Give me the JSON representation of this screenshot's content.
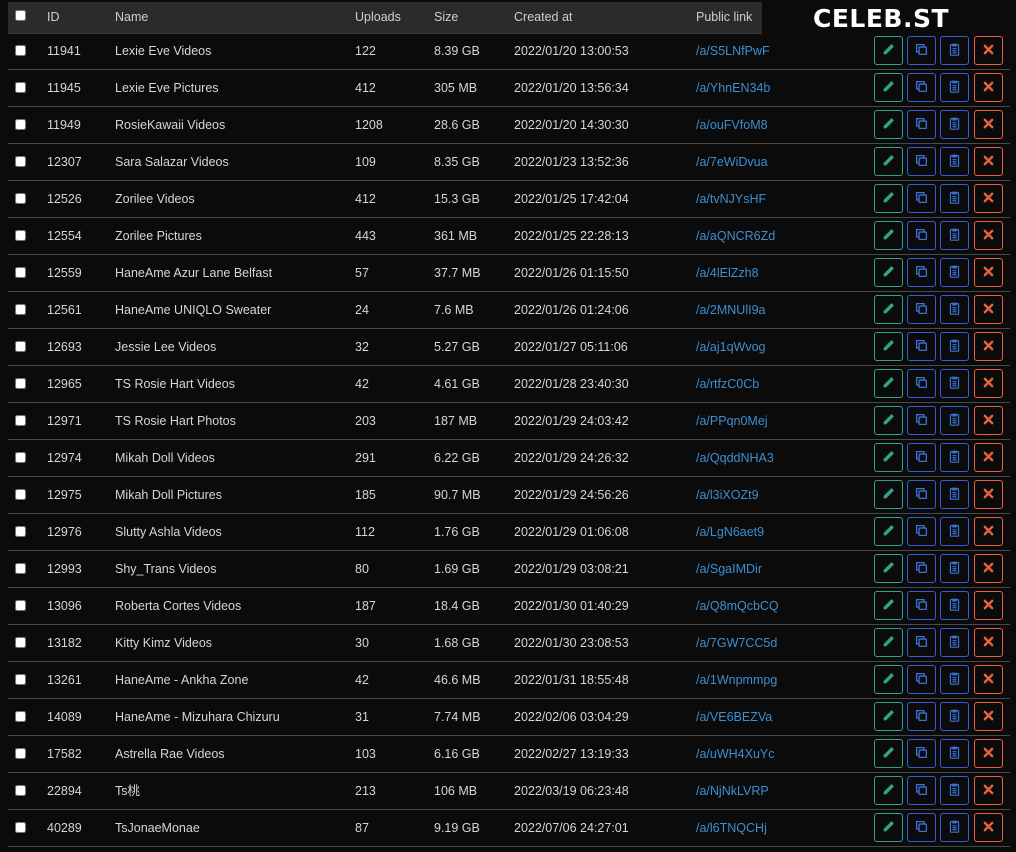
{
  "brand": {
    "logo": "CELEB.ST"
  },
  "table": {
    "headers": {
      "id": "ID",
      "name": "Name",
      "uploads": "Uploads",
      "size": "Size",
      "created": "Created at",
      "link": "Public link"
    },
    "rows": [
      {
        "id": "11941",
        "name": "Lexie Eve Videos",
        "uploads": "122",
        "size": "8.39 GB",
        "created": "2022/01/20 13:00:53",
        "link": "/a/S5LNfPwF"
      },
      {
        "id": "11945",
        "name": "Lexie Eve Pictures",
        "uploads": "412",
        "size": "305 MB",
        "created": "2022/01/20 13:56:34",
        "link": "/a/YhnEN34b"
      },
      {
        "id": "11949",
        "name": "RosieKawaii Videos",
        "uploads": "1208",
        "size": "28.6 GB",
        "created": "2022/01/20 14:30:30",
        "link": "/a/ouFVfoM8"
      },
      {
        "id": "12307",
        "name": "Sara Salazar Videos",
        "uploads": "109",
        "size": "8.35 GB",
        "created": "2022/01/23 13:52:36",
        "link": "/a/7eWiDvua"
      },
      {
        "id": "12526",
        "name": "Zorilee Videos",
        "uploads": "412",
        "size": "15.3 GB",
        "created": "2022/01/25 17:42:04",
        "link": "/a/tvNJYsHF"
      },
      {
        "id": "12554",
        "name": "Zorilee Pictures",
        "uploads": "443",
        "size": "361 MB",
        "created": "2022/01/25 22:28:13",
        "link": "/a/aQNCR6Zd"
      },
      {
        "id": "12559",
        "name": "HaneAme Azur Lane Belfast",
        "uploads": "57",
        "size": "37.7 MB",
        "created": "2022/01/26 01:15:50",
        "link": "/a/4lElZzh8"
      },
      {
        "id": "12561",
        "name": "HaneAme UNIQLO Sweater",
        "uploads": "24",
        "size": "7.6 MB",
        "created": "2022/01/26 01:24:06",
        "link": "/a/2MNUlI9a"
      },
      {
        "id": "12693",
        "name": "Jessie Lee Videos",
        "uploads": "32",
        "size": "5.27 GB",
        "created": "2022/01/27 05:11:06",
        "link": "/a/aj1qWvog"
      },
      {
        "id": "12965",
        "name": "TS Rosie Hart Videos",
        "uploads": "42",
        "size": "4.61 GB",
        "created": "2022/01/28 23:40:30",
        "link": "/a/rtfzC0Cb"
      },
      {
        "id": "12971",
        "name": "TS Rosie Hart Photos",
        "uploads": "203",
        "size": "187 MB",
        "created": "2022/01/29 24:03:42",
        "link": "/a/PPqn0Mej"
      },
      {
        "id": "12974",
        "name": "Mikah Doll Videos",
        "uploads": "291",
        "size": "6.22 GB",
        "created": "2022/01/29 24:26:32",
        "link": "/a/QqddNHA3"
      },
      {
        "id": "12975",
        "name": "Mikah Doll Pictures",
        "uploads": "185",
        "size": "90.7 MB",
        "created": "2022/01/29 24:56:26",
        "link": "/a/l3iXOZt9"
      },
      {
        "id": "12976",
        "name": "Slutty Ashla Videos",
        "uploads": "112",
        "size": "1.76 GB",
        "created": "2022/01/29 01:06:08",
        "link": "/a/LgN6aet9"
      },
      {
        "id": "12993",
        "name": "Shy_Trans Videos",
        "uploads": "80",
        "size": "1.69 GB",
        "created": "2022/01/29 03:08:21",
        "link": "/a/SgaIMDir"
      },
      {
        "id": "13096",
        "name": "Roberta Cortes Videos",
        "uploads": "187",
        "size": "18.4 GB",
        "created": "2022/01/30 01:40:29",
        "link": "/a/Q8mQcbCQ"
      },
      {
        "id": "13182",
        "name": "Kitty Kimz Videos",
        "uploads": "30",
        "size": "1.68 GB",
        "created": "2022/01/30 23:08:53",
        "link": "/a/7GW7CC5d"
      },
      {
        "id": "13261",
        "name": "HaneAme - Ankha Zone",
        "uploads": "42",
        "size": "46.6 MB",
        "created": "2022/01/31 18:55:48",
        "link": "/a/1Wnpmmpg"
      },
      {
        "id": "14089",
        "name": "HaneAme - Mizuhara Chizuru",
        "uploads": "31",
        "size": "7.74 MB",
        "created": "2022/02/06 03:04:29",
        "link": "/a/VE6BEZVa"
      },
      {
        "id": "17582",
        "name": "Astrella Rae Videos",
        "uploads": "103",
        "size": "6.16 GB",
        "created": "2022/02/27 13:19:33",
        "link": "/a/uWH4XuYc"
      },
      {
        "id": "22894",
        "name": "Ts桃",
        "uploads": "213",
        "size": "106 MB",
        "created": "2022/03/19 06:23:48",
        "link": "/a/NjNkLVRP"
      },
      {
        "id": "40289",
        "name": "TsJonaeMonae",
        "uploads": "87",
        "size": "9.19 GB",
        "created": "2022/07/06 24:27:01",
        "link": "/a/l6TNQCHj"
      }
    ]
  },
  "icons": {
    "edit": "pencil-icon",
    "copy": "copy-icon",
    "list": "clipboard-icon",
    "delete": "close-icon"
  },
  "colors": {
    "edit": "#2ea58b",
    "copy": "#3b72d6",
    "delete": "#e8603f",
    "link": "#3e8ed0",
    "header_bg": "#2b2b2b"
  }
}
